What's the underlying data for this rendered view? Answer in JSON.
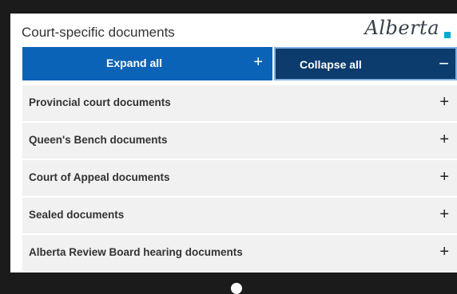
{
  "header": {
    "title": "Court-specific documents",
    "logo_text": "Alberta"
  },
  "buttons": {
    "expand_label": "Expand all",
    "expand_symbol": "+",
    "collapse_label": "Collapse all",
    "collapse_symbol": "−"
  },
  "accordion": {
    "items": [
      {
        "label": "Provincial court documents",
        "symbol": "+"
      },
      {
        "label": "Queen's Bench documents",
        "symbol": "+"
      },
      {
        "label": "Court of Appeal documents",
        "symbol": "+"
      },
      {
        "label": "Sealed documents",
        "symbol": "+"
      },
      {
        "label": "Alberta Review Board hearing documents",
        "symbol": "+"
      }
    ]
  },
  "colors": {
    "expand_bg": "#0b63b8",
    "collapse_bg": "#0c3b6e",
    "item_bg": "#f1f1f1",
    "logo_accent": "#00aad2"
  }
}
